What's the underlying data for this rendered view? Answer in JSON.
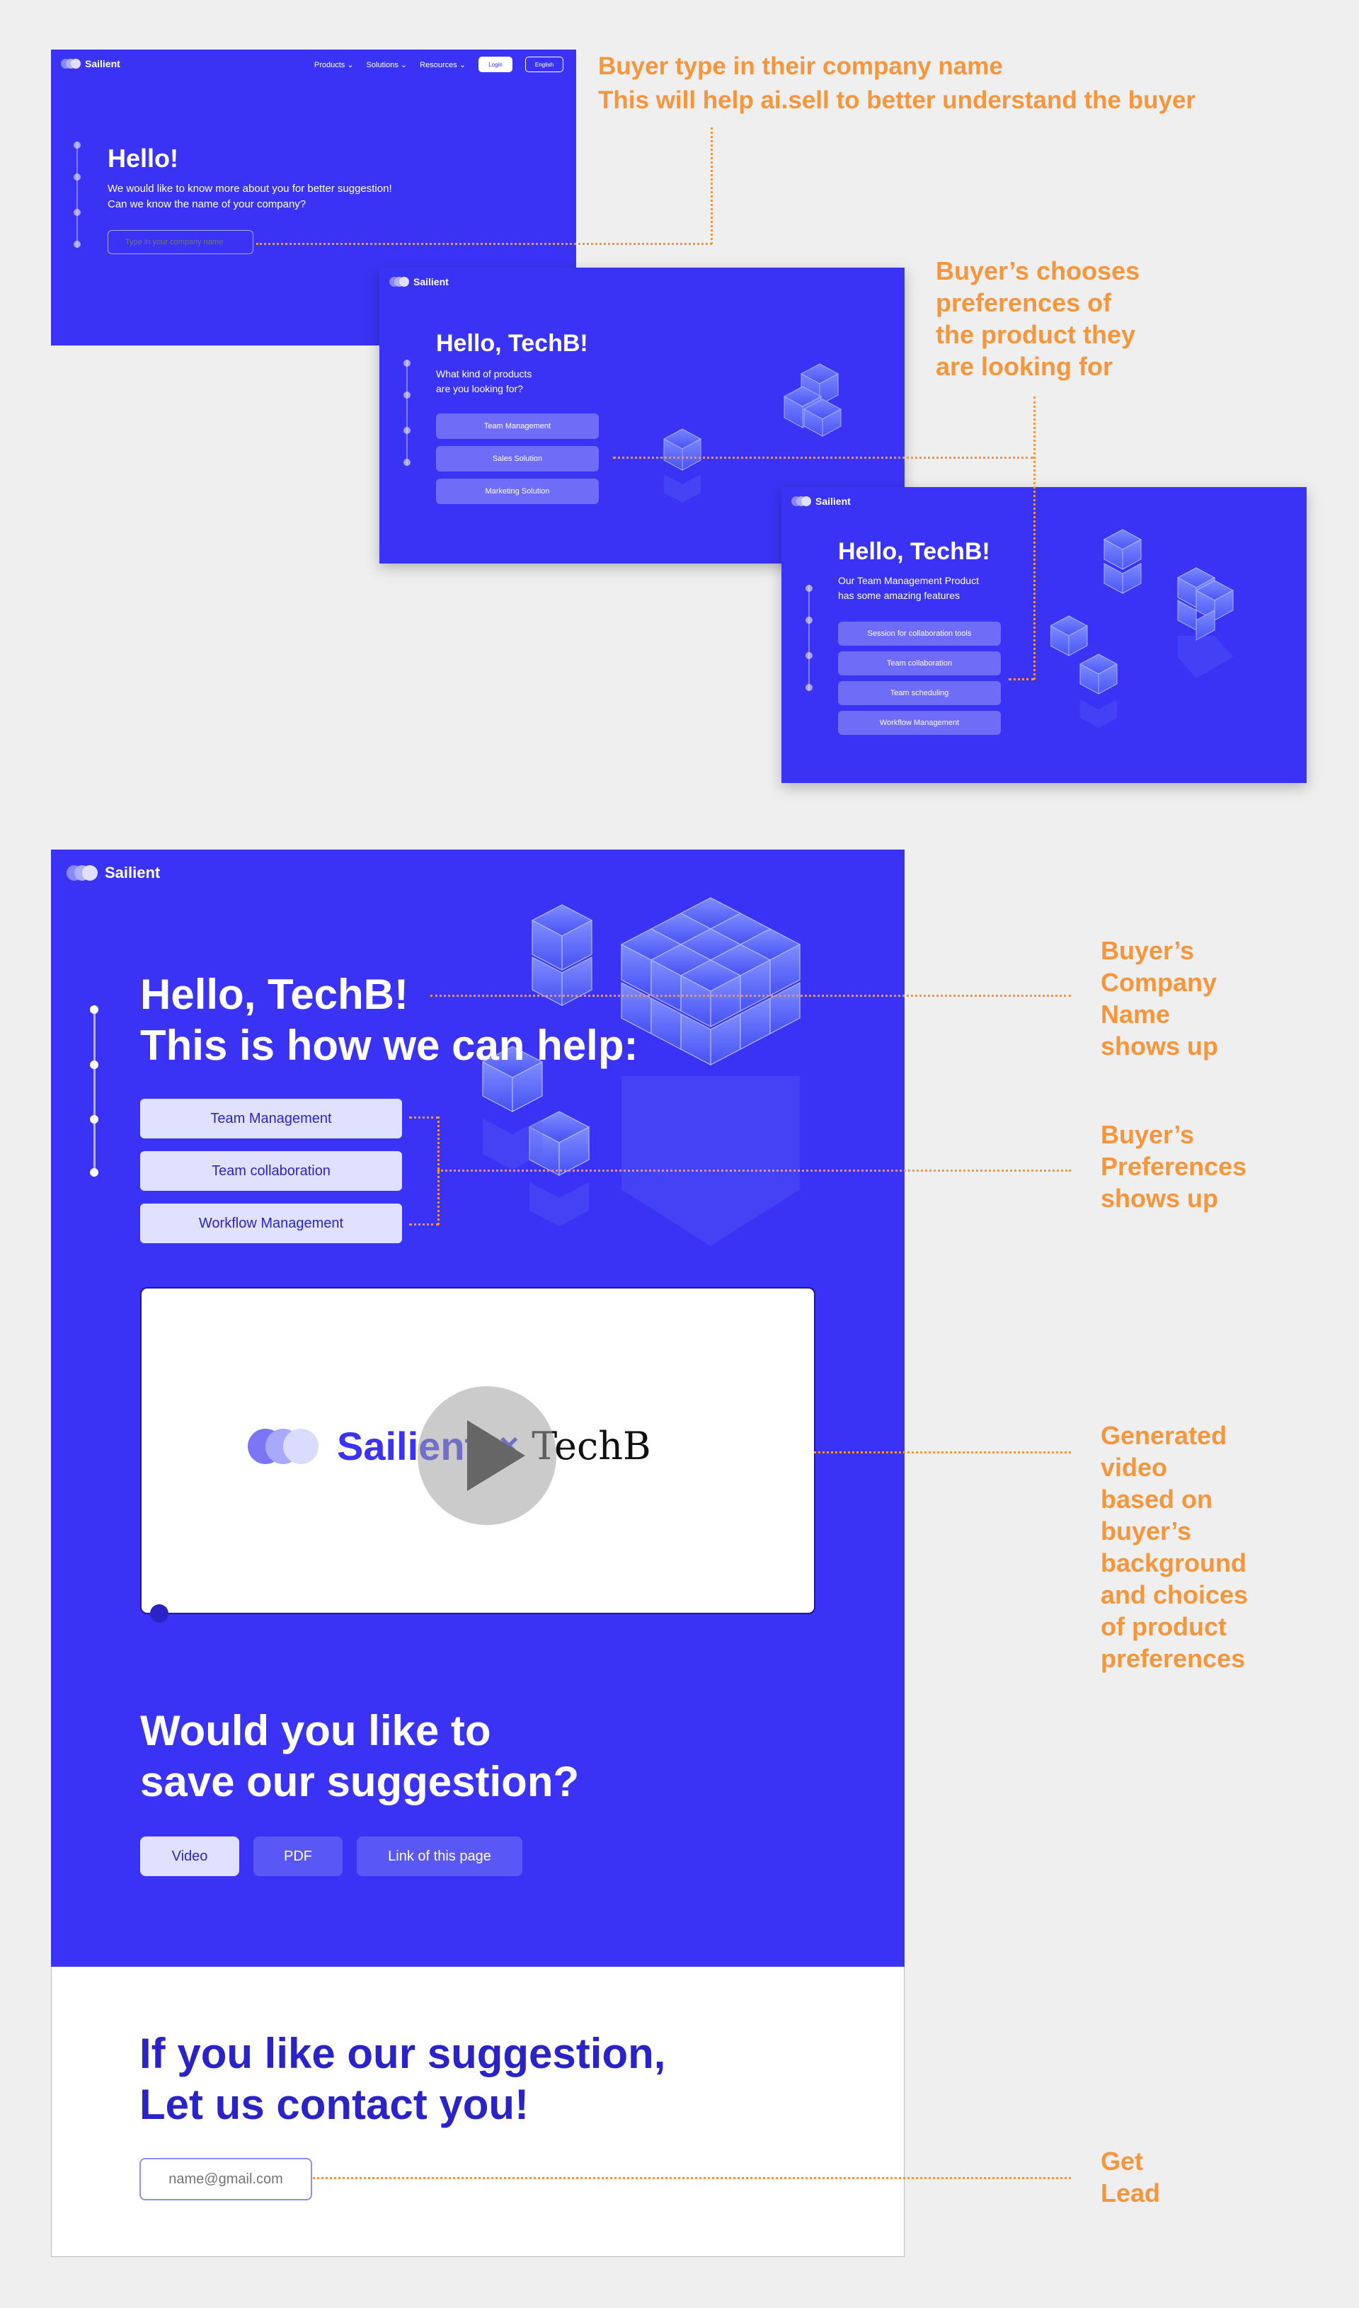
{
  "brand": {
    "name": "Sailient"
  },
  "colors": {
    "primary": "#3a33f5",
    "accent": "#f7953b",
    "pill": "#6f6cf8",
    "pill_light": "#dfe1ff",
    "dark_text": "#2a24c8"
  },
  "screen1": {
    "nav": {
      "products": "Products",
      "solutions": "Solutions",
      "resources": "Resources",
      "login": "Login",
      "language": "English"
    },
    "title": "Hello!",
    "line1": "We would like to know more about you for better suggestion!",
    "line2": "Can we know the name of your company?",
    "input_placeholder": "Type in your company name"
  },
  "screen2": {
    "title": "Hello, TechB!",
    "line1": "What kind of products",
    "line2": "are you looking for?",
    "options": [
      "Team Management",
      "Sales Solution",
      "Marketing Solution"
    ]
  },
  "screen3": {
    "title": "Hello, TechB!",
    "line1": "Our Team Management Product",
    "line2": "has some amazing features",
    "options": [
      "Session for collaboration tools",
      "Team collaboration",
      "Team scheduling",
      "Workflow Management"
    ]
  },
  "main": {
    "title_line1": "Hello, TechB!",
    "title_line2": "This is how we can help:",
    "options": [
      "Team Management",
      "Team collaboration",
      "Workflow Management"
    ],
    "video": {
      "brand": "Sailient",
      "times": "×",
      "partner": "TechB"
    },
    "save_title_line1": "Would you like to",
    "save_title_line2": "save our suggestion?",
    "save_buttons": [
      "Video",
      "PDF",
      "Link of this page"
    ],
    "contact_title_line1": "If you like our suggestion,",
    "contact_title_line2": "Let us contact you!",
    "email_placeholder": "name@gmail.com"
  },
  "annotations": {
    "a1_line1": "Buyer type in their company name",
    "a1_line2": "This will help ai.sell to better understand the buyer",
    "a2": [
      "Buyer’s chooses",
      "preferences of",
      "the product they",
      "are looking for"
    ],
    "a3": [
      "Buyer’s",
      "Company",
      "Name",
      "shows up"
    ],
    "a4": [
      "Buyer’s",
      "Preferences",
      "shows up"
    ],
    "a5": [
      "Generated",
      "video",
      "based on",
      "buyer’s",
      "background",
      "and choices",
      "of product",
      "preferences"
    ],
    "a6": [
      "Get",
      "Lead"
    ]
  }
}
